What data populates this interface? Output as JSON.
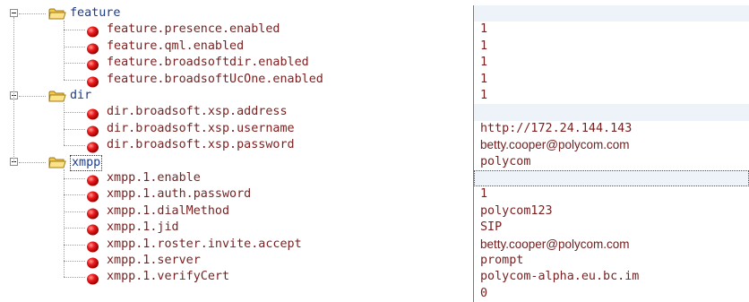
{
  "tree": {
    "groups": [
      {
        "name": "feature",
        "focused": false,
        "params": [
          "feature.presence.enabled",
          "feature.qml.enabled",
          "feature.broadsoftdir.enabled",
          "feature.broadsoftUcOne.enabled"
        ]
      },
      {
        "name": "dir",
        "focused": false,
        "params": [
          "dir.broadsoft.xsp.address",
          "dir.broadsoft.xsp.username",
          "dir.broadsoft.xsp.password"
        ]
      },
      {
        "name": "xmpp",
        "focused": true,
        "params": [
          "xmpp.1.enable",
          "xmpp.1.auth.password",
          "xmpp.1.dialMethod",
          "xmpp.1.jid",
          "xmpp.1.roster.invite.accept",
          "xmpp.1.server",
          "xmpp.1.verifyCert"
        ]
      }
    ]
  },
  "values": [
    {
      "text": "",
      "font": "mono",
      "style": "band"
    },
    {
      "text": "1",
      "font": "mono",
      "style": ""
    },
    {
      "text": "1",
      "font": "mono",
      "style": ""
    },
    {
      "text": "1",
      "font": "mono",
      "style": ""
    },
    {
      "text": "1",
      "font": "mono",
      "style": ""
    },
    {
      "text": "1",
      "font": "mono",
      "style": ""
    },
    {
      "text": "",
      "font": "mono",
      "style": "band"
    },
    {
      "text": "http://172.24.144.143",
      "font": "mono",
      "style": ""
    },
    {
      "text": "betty.cooper@polycom.com",
      "font": "sans",
      "style": ""
    },
    {
      "text": "polycom",
      "font": "mono",
      "style": ""
    },
    {
      "text": "",
      "font": "mono",
      "style": "focused"
    },
    {
      "text": "1",
      "font": "mono",
      "style": ""
    },
    {
      "text": "polycom123",
      "font": "mono",
      "style": ""
    },
    {
      "text": "SIP",
      "font": "mono",
      "style": ""
    },
    {
      "text": "betty.cooper@polycom.com",
      "font": "sans",
      "style": ""
    },
    {
      "text": "prompt",
      "font": "mono",
      "style": ""
    },
    {
      "text": "polycom-alpha.eu.bc.im",
      "font": "mono",
      "style": ""
    },
    {
      "text": "0",
      "font": "mono",
      "style": ""
    }
  ],
  "colors": {
    "folder_text": "#1e3c8c",
    "param_text": "#7a1f1f",
    "bullet_red": "#e01010",
    "folder_yellow": "#f7d866",
    "band_background": "#eef3f9"
  },
  "icons": {
    "folder": "folder-icon",
    "parameter": "red-bullet-icon",
    "expander": "collapse-minus-icon"
  }
}
